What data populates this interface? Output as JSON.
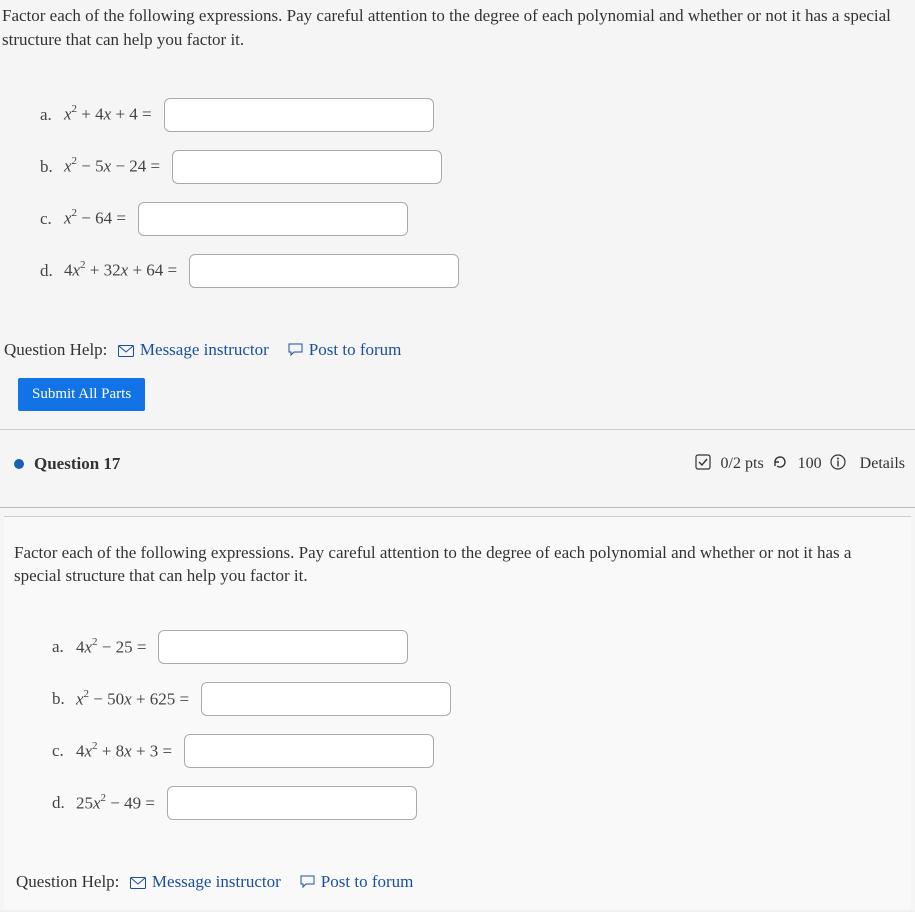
{
  "q1": {
    "instructions": "Factor each of the following expressions. Pay careful attention to the degree of each polynomial and whether or not it has a special structure that can help you factor it.",
    "parts": [
      {
        "label": "a.",
        "expr_html": "<span><i>x</i><span class='sup'>2</span> + 4<i>x</i> + 4 =</span>"
      },
      {
        "label": "b.",
        "expr_html": "<span><i>x</i><span class='sup'>2</span> − 5<i>x</i> − 24 =</span>"
      },
      {
        "label": "c.",
        "expr_html": "<span><i>x</i><span class='sup'>2</span> − 64 =</span>"
      },
      {
        "label": "d.",
        "expr_html": "<span>4<i>x</i><span class='sup'>2</span> + 32<i>x</i> + 64 =</span>"
      }
    ],
    "help_label": "Question Help:",
    "msg_link": "Message instructor",
    "post_link": "Post to forum",
    "submit_label": "Submit All Parts"
  },
  "q2": {
    "title": "Question 17",
    "score": "0/2 pts",
    "attempts": "100",
    "details": "Details",
    "instructions": "Factor each of the following expressions. Pay careful attention to the degree of each polynomial and whether or not it has a special structure that can help you factor it.",
    "parts": [
      {
        "label": "a.",
        "expr_html": "<span>4<i>x</i><span class='sup'>2</span> − 25 =</span>"
      },
      {
        "label": "b.",
        "expr_html": "<span><i>x</i><span class='sup'>2</span> − 50<i>x</i> + 625 =</span>"
      },
      {
        "label": "c.",
        "expr_html": "<span>4<i>x</i><span class='sup'>2</span> + 8<i>x</i> + 3 =</span>"
      },
      {
        "label": "d.",
        "expr_html": "<span>25<i>x</i><span class='sup'>2</span> − 49 =</span>"
      }
    ],
    "help_label": "Question Help:",
    "msg_link": "Message instructor",
    "post_link": "Post to forum"
  }
}
